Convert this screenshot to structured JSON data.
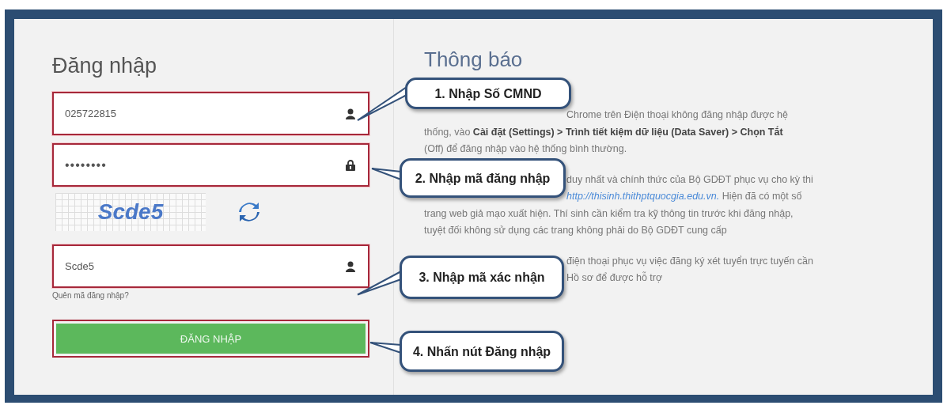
{
  "login": {
    "title": "Đăng nhập",
    "fields": [
      {
        "kind": "id",
        "value": "025722815"
      },
      {
        "kind": "password",
        "value": "••••••••"
      }
    ],
    "captcha": {
      "code": "Scde5"
    },
    "captcha_field": {
      "kind": "id",
      "value": "Scde5"
    },
    "forgot_link": "Quên mã đăng nhập?",
    "submit_button": "ĐĂNG NHẬP"
  },
  "notice": {
    "title": "Thông báo",
    "paragraphs": [
      {
        "lines": [
          {
            "kind": "after_callout",
            "text": "Chrome trên Điện thoại không đăng nhập được hệ"
          },
          {
            "kind": "full",
            "text": "thống, vào **Cài đặt (Settings) > Trình tiết kiệm dữ liệu (Data Saver) > Chọn Tắt**"
          },
          {
            "kind": "full",
            "text": "(Off) để đăng nhập vào hệ thống bình thường."
          }
        ]
      },
      {
        "lines": [
          {
            "kind": "after_callout",
            "text": "duy nhất và chính thức của Bộ GDĐT phục vụ cho kỳ thi"
          },
          {
            "kind": "after_callout",
            "link": "http://thisinh.thithptquocgia.edu.vn.",
            "text": " Hiện đã có một số"
          },
          {
            "kind": "full",
            "text": "trang web giả mạo xuất hiện. Thí sinh cần kiểm tra kỹ thông tin trước khi đăng nhập,"
          },
          {
            "kind": "full",
            "text": "tuyệt đối không sử dụng các trang không phải do Bộ GDĐT cung cấp"
          }
        ]
      },
      {
        "lines": [
          {
            "kind": "after_callout",
            "text": "điện thoại phục vụ việc đăng ký xét tuyển trực tuyến cần"
          },
          {
            "kind": "after_callout",
            "text": "Hồ sơ để được hỗ trợ"
          }
        ]
      }
    ]
  },
  "callouts": [
    {
      "text": "1. Nhập Số CMND"
    },
    {
      "text": "2. Nhập mã đăng nhập"
    },
    {
      "text": "3. Nhập mã xác nhận"
    },
    {
      "text": "4. Nhấn nút Đăng nhập"
    }
  ]
}
